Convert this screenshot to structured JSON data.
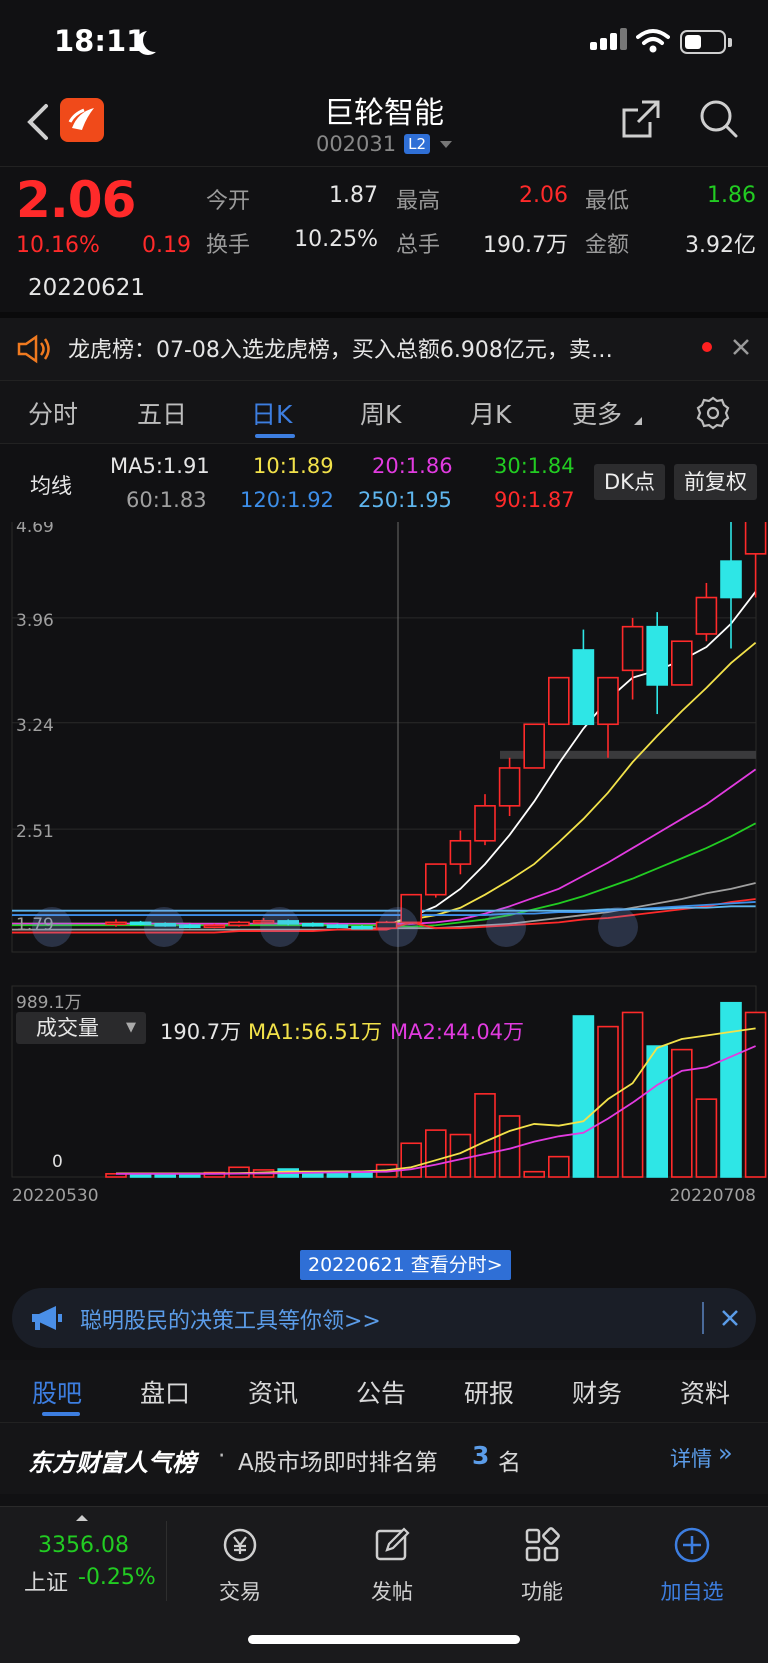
{
  "status": {
    "time": "18:11"
  },
  "header": {
    "name": "巨轮智能",
    "code": "002031",
    "level_badge": "L2"
  },
  "quote": {
    "price": "2.06",
    "change_pct": "10.16%",
    "change": "0.19",
    "date": "20220621",
    "fields": [
      {
        "label": "今开",
        "value": "1.87",
        "color": "#e6e6e6"
      },
      {
        "label": "最高",
        "value": "2.06",
        "color": "#ff2a2a"
      },
      {
        "label": "最低",
        "value": "1.86",
        "color": "#22cc22"
      },
      {
        "label": "换手",
        "value": "10.25%",
        "color": "#e6e6e6"
      },
      {
        "label": "总手",
        "value": "190.7万",
        "color": "#e6e6e6"
      },
      {
        "label": "金额",
        "value": "3.92亿",
        "color": "#e6e6e6"
      }
    ]
  },
  "notice": {
    "text": "龙虎榜：07-08入选龙虎榜，买入总额6.908亿元，卖…"
  },
  "period_tabs": [
    "分时",
    "五日",
    "日K",
    "周K",
    "月K",
    "更多"
  ],
  "ma": {
    "label": "均线",
    "items": [
      {
        "text": "MA5:1.91",
        "color": "#e6e6e6"
      },
      {
        "text": "10:1.89",
        "color": "#f2e24a"
      },
      {
        "text": "20:1.86",
        "color": "#e23be0"
      },
      {
        "text": "30:1.84",
        "color": "#22cc22"
      },
      {
        "text": "60:1.83",
        "color": "#a0a0a0"
      },
      {
        "text": "120:1.92",
        "color": "#3d8ee8"
      },
      {
        "text": "250:1.95",
        "color": "#5fb6ee"
      },
      {
        "text": "90:1.87",
        "color": "#ff2a2a"
      }
    ],
    "dk_button": "DK点",
    "adjust_button": "前复权"
  },
  "chart_data": {
    "type": "candlestick",
    "price_ticks": [
      "4.69",
      "3.96",
      "3.24",
      "2.51",
      "1.79"
    ],
    "price_range": [
      1.79,
      4.69
    ],
    "volume": {
      "label": "成交量",
      "last": "190.7万",
      "ma1": "MA1:56.51万",
      "ma2": "MA2:44.04万",
      "max_tick": "989.1万",
      "min_tick": "0",
      "range": [
        0,
        989.1
      ]
    },
    "x_start": "20220530",
    "x_end": "20220708",
    "crosshair_label": "20220621 查看分时>",
    "candles": [
      {
        "open": 1.86,
        "close": 1.87,
        "high": 1.89,
        "low": 1.84,
        "vol": 18
      },
      {
        "open": 1.87,
        "close": 1.86,
        "high": 1.88,
        "low": 1.85,
        "vol": 16
      },
      {
        "open": 1.86,
        "close": 1.85,
        "high": 1.87,
        "low": 1.84,
        "vol": 20
      },
      {
        "open": 1.85,
        "close": 1.84,
        "high": 1.86,
        "low": 1.83,
        "vol": 18
      },
      {
        "open": 1.84,
        "close": 1.85,
        "high": 1.86,
        "low": 1.83,
        "vol": 25
      },
      {
        "open": 1.85,
        "close": 1.87,
        "high": 1.88,
        "low": 1.84,
        "vol": 55
      },
      {
        "open": 1.87,
        "close": 1.88,
        "high": 1.9,
        "low": 1.86,
        "vol": 40
      },
      {
        "open": 1.88,
        "close": 1.86,
        "high": 1.89,
        "low": 1.85,
        "vol": 45
      },
      {
        "open": 1.86,
        "close": 1.85,
        "high": 1.87,
        "low": 1.84,
        "vol": 30
      },
      {
        "open": 1.85,
        "close": 1.84,
        "high": 1.86,
        "low": 1.83,
        "vol": 25
      },
      {
        "open": 1.84,
        "close": 1.83,
        "high": 1.85,
        "low": 1.82,
        "vol": 28
      },
      {
        "open": 1.83,
        "close": 1.87,
        "high": 1.88,
        "low": 1.82,
        "vol": 70
      },
      {
        "open": 1.87,
        "close": 2.06,
        "high": 2.06,
        "low": 1.86,
        "vol": 190.7
      },
      {
        "open": 2.06,
        "close": 2.27,
        "high": 2.27,
        "low": 2.04,
        "vol": 265
      },
      {
        "open": 2.27,
        "close": 2.43,
        "high": 2.5,
        "low": 2.2,
        "vol": 240
      },
      {
        "open": 2.43,
        "close": 2.67,
        "high": 2.75,
        "low": 2.4,
        "vol": 470
      },
      {
        "open": 2.67,
        "close": 2.93,
        "high": 3.0,
        "low": 2.6,
        "vol": 345
      },
      {
        "open": 2.93,
        "close": 3.23,
        "high": 3.23,
        "low": 2.93,
        "vol": 30
      },
      {
        "open": 3.23,
        "close": 3.55,
        "high": 3.55,
        "low": 3.23,
        "vol": 115
      },
      {
        "open": 3.74,
        "close": 3.23,
        "high": 3.88,
        "low": 3.23,
        "vol": 910
      },
      {
        "open": 3.23,
        "close": 3.55,
        "high": 3.55,
        "low": 3.0,
        "vol": 850
      },
      {
        "open": 3.6,
        "close": 3.9,
        "high": 3.96,
        "low": 3.4,
        "vol": 930
      },
      {
        "open": 3.9,
        "close": 3.5,
        "high": 4.0,
        "low": 3.3,
        "vol": 740
      },
      {
        "open": 3.5,
        "close": 3.8,
        "high": 3.8,
        "low": 3.5,
        "vol": 720
      },
      {
        "open": 3.85,
        "close": 4.1,
        "high": 4.2,
        "low": 3.8,
        "vol": 440
      },
      {
        "open": 4.35,
        "close": 4.1,
        "high": 4.69,
        "low": 3.75,
        "vol": 985
      },
      {
        "open": 4.4,
        "close": 4.69,
        "high": 4.69,
        "low": 4.1,
        "vol": 930
      }
    ],
    "ma_lines": {
      "ma5": [
        1.86,
        1.86,
        1.86,
        1.86,
        1.85,
        1.85,
        1.86,
        1.86,
        1.86,
        1.86,
        1.85,
        1.85,
        1.91,
        1.98,
        2.1,
        2.27,
        2.47,
        2.7,
        2.96,
        3.2,
        3.4,
        3.55,
        3.6,
        3.67,
        3.76,
        3.92,
        4.14
      ],
      "ma10": [
        1.86,
        1.86,
        1.86,
        1.86,
        1.86,
        1.86,
        1.86,
        1.86,
        1.86,
        1.86,
        1.85,
        1.86,
        1.89,
        1.92,
        1.97,
        2.06,
        2.16,
        2.27,
        2.42,
        2.58,
        2.76,
        2.97,
        3.15,
        3.32,
        3.48,
        3.65,
        3.79
      ],
      "ma20": [
        1.86,
        1.86,
        1.86,
        1.86,
        1.86,
        1.86,
        1.86,
        1.86,
        1.86,
        1.86,
        1.86,
        1.86,
        1.86,
        1.87,
        1.89,
        1.93,
        1.98,
        2.04,
        2.1,
        2.19,
        2.28,
        2.38,
        2.48,
        2.58,
        2.68,
        2.8,
        2.92
      ],
      "ma30": [
        1.85,
        1.85,
        1.85,
        1.85,
        1.85,
        1.85,
        1.85,
        1.85,
        1.85,
        1.85,
        1.85,
        1.85,
        1.84,
        1.85,
        1.87,
        1.89,
        1.92,
        1.96,
        2.0,
        2.05,
        2.11,
        2.17,
        2.24,
        2.31,
        2.38,
        2.46,
        2.55
      ],
      "ma60": [
        1.82,
        1.82,
        1.82,
        1.82,
        1.82,
        1.82,
        1.82,
        1.82,
        1.82,
        1.82,
        1.83,
        1.83,
        1.83,
        1.83,
        1.84,
        1.85,
        1.86,
        1.88,
        1.9,
        1.92,
        1.94,
        1.97,
        2.0,
        2.03,
        2.07,
        2.1,
        2.14
      ],
      "ma90": [
        1.8,
        1.8,
        1.8,
        1.8,
        1.8,
        1.81,
        1.81,
        1.81,
        1.81,
        1.82,
        1.82,
        1.82,
        1.87,
        1.83,
        1.83,
        1.84,
        1.85,
        1.86,
        1.87,
        1.89,
        1.9,
        1.92,
        1.94,
        1.96,
        1.98,
        2.01,
        2.03
      ],
      "ma120": [
        1.92,
        1.92,
        1.92,
        1.92,
        1.92,
        1.92,
        1.92,
        1.92,
        1.92,
        1.92,
        1.92,
        1.92,
        1.92,
        1.92,
        1.92,
        1.92,
        1.93,
        1.93,
        1.94,
        1.94,
        1.95,
        1.96,
        1.97,
        1.98,
        1.99,
        2.0,
        2.01
      ],
      "ma250": [
        1.95,
        1.95,
        1.95,
        1.95,
        1.95,
        1.95,
        1.95,
        1.95,
        1.95,
        1.95,
        1.95,
        1.95,
        1.95,
        1.95,
        1.95,
        1.95,
        1.95,
        1.95,
        1.95,
        1.95,
        1.96,
        1.96,
        1.96,
        1.97,
        1.97,
        1.98,
        1.98
      ]
    },
    "vol_ma1": [
      20,
      20,
      20,
      20,
      20,
      22,
      25,
      30,
      30,
      32,
      32,
      38,
      55,
      95,
      135,
      200,
      260,
      300,
      290,
      315,
      440,
      530,
      730,
      780,
      800,
      820,
      840
    ],
    "vol_ma2": [
      18,
      18,
      18,
      18,
      18,
      19,
      20,
      22,
      24,
      26,
      28,
      30,
      44,
      70,
      100,
      130,
      160,
      200,
      230,
      250,
      330,
      420,
      520,
      600,
      620,
      680,
      740
    ],
    "ref_price_line": 3.02
  },
  "ad": {
    "text": "聪明股民的决策工具等你领>>"
  },
  "info_tabs": [
    "股吧",
    "盘口",
    "资讯",
    "公告",
    "研报",
    "财务",
    "资料"
  ],
  "rank": {
    "brand": "东方财富人气榜",
    "dot": "·",
    "text": "A股市场即时排名第",
    "rank": "3",
    "suffix": "名",
    "detail": "详情"
  },
  "bottom_nav": {
    "index_value": "3356.08",
    "index_name": "上证",
    "index_change": "-0.25%",
    "items": [
      {
        "label": "交易",
        "icon": "trade-icon"
      },
      {
        "label": "发帖",
        "icon": "compose-icon"
      },
      {
        "label": "功能",
        "icon": "grid-icon"
      },
      {
        "label": "加自选",
        "icon": "add-watchlist-icon"
      }
    ]
  }
}
